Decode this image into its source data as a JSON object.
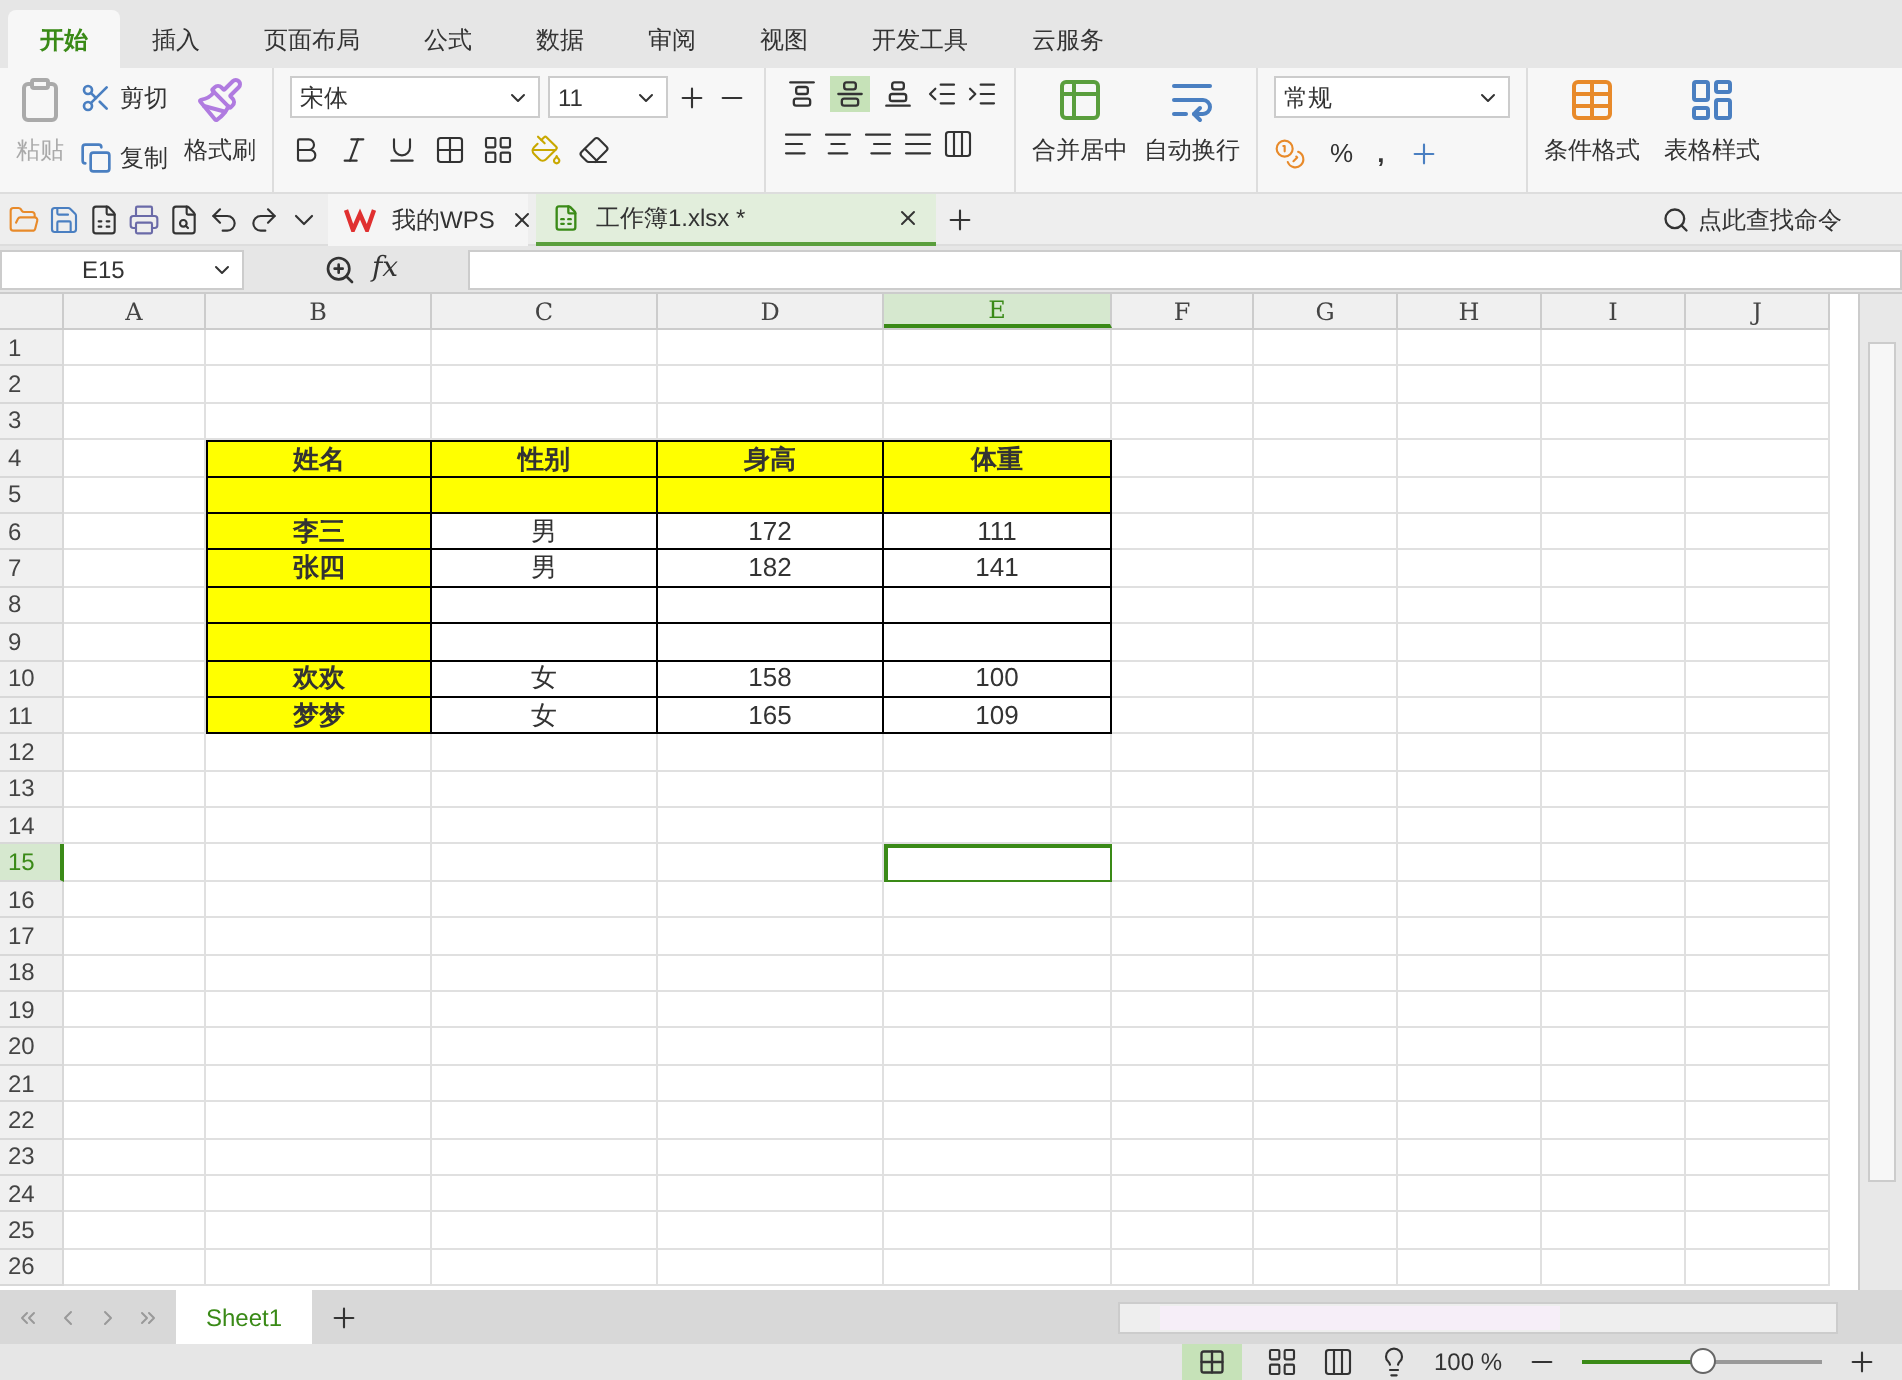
{
  "menu_tabs": [
    {
      "label": "开始",
      "selected": true
    },
    {
      "label": "插入",
      "selected": false
    },
    {
      "label": "页面布局",
      "selected": false
    },
    {
      "label": "公式",
      "selected": false
    },
    {
      "label": "数据",
      "selected": false
    },
    {
      "label": "审阅",
      "selected": false
    },
    {
      "label": "视图",
      "selected": false
    },
    {
      "label": "开发工具",
      "selected": false
    },
    {
      "label": "云服务",
      "selected": false
    }
  ],
  "clipboard": {
    "paste": {
      "label": "粘贴",
      "disabled": true
    },
    "cut": "剪切",
    "copy": "复制",
    "format_painter": "格式刷"
  },
  "font": {
    "name": "宋体",
    "size": "11"
  },
  "alignment": [
    {
      "kind": "top",
      "selected": false
    },
    {
      "kind": "middle",
      "selected": true
    },
    {
      "kind": "bottom",
      "selected": false
    }
  ],
  "merge": "合并居中",
  "wrap": "自动换行",
  "number": {
    "format": "常规",
    "percent": "%",
    "comma": ","
  },
  "styles": {
    "conditional": "条件格式",
    "table_style": "表格样式"
  },
  "doc_tabs": [
    {
      "label": "我的WPS",
      "kind": "home",
      "selected": false
    },
    {
      "label": "工作簿1.xlsx *",
      "kind": "sheet",
      "selected": true
    }
  ],
  "command_search": {
    "placeholder": "点此查找命令"
  },
  "name_box": "E15",
  "formula_icon": "fx",
  "columns": [
    {
      "label": "A",
      "selected": false
    },
    {
      "label": "B",
      "selected": false
    },
    {
      "label": "C",
      "selected": false
    },
    {
      "label": "D",
      "selected": false
    },
    {
      "label": "E",
      "selected": true
    },
    {
      "label": "F",
      "selected": false
    },
    {
      "label": "G",
      "selected": false
    },
    {
      "label": "H",
      "selected": false
    },
    {
      "label": "I",
      "selected": false
    },
    {
      "label": "J",
      "selected": false
    }
  ],
  "rows": [
    {
      "number": "1",
      "selected": false
    },
    {
      "number": "2",
      "selected": false
    },
    {
      "number": "3",
      "selected": false
    },
    {
      "number": "4",
      "selected": false,
      "cells": [
        {
          "text": "姓名",
          "fill": true,
          "bold": true
        },
        {
          "text": "性别",
          "fill": true,
          "bold": true
        },
        {
          "text": "身高",
          "fill": true,
          "bold": true
        },
        {
          "text": "体重",
          "fill": true,
          "bold": true
        }
      ]
    },
    {
      "number": "5",
      "selected": false,
      "cells": [
        {
          "fill": true
        },
        {
          "fill": true
        },
        {
          "fill": true
        },
        {
          "fill": true
        }
      ]
    },
    {
      "number": "6",
      "selected": false,
      "cells": [
        {
          "text": "李三",
          "fill": true,
          "bold": true
        },
        {
          "text": "男",
          "fill": false,
          "bold": false
        },
        {
          "text": "172",
          "fill": false,
          "bold": false
        },
        {
          "text": "111",
          "fill": false,
          "bold": false
        }
      ]
    },
    {
      "number": "7",
      "selected": false,
      "cells": [
        {
          "text": "张四",
          "fill": true,
          "bold": true
        },
        {
          "text": "男",
          "fill": false,
          "bold": false
        },
        {
          "text": "182",
          "fill": false,
          "bold": false
        },
        {
          "text": "141",
          "fill": false,
          "bold": false
        }
      ]
    },
    {
      "number": "8",
      "selected": false,
      "cells": [
        {
          "fill": true
        },
        {
          "fill": false
        },
        {
          "fill": false
        },
        {
          "fill": false
        }
      ]
    },
    {
      "number": "9",
      "selected": false,
      "cells": [
        {
          "fill": true
        },
        {
          "fill": false
        },
        {
          "fill": false
        },
        {
          "fill": false
        }
      ]
    },
    {
      "number": "10",
      "selected": false,
      "cells": [
        {
          "text": "欢欢",
          "fill": true,
          "bold": true
        },
        {
          "text": "女",
          "fill": false,
          "bold": false
        },
        {
          "text": "158",
          "fill": false,
          "bold": false
        },
        {
          "text": "100",
          "fill": false,
          "bold": false
        }
      ]
    },
    {
      "number": "11",
      "selected": false,
      "cells": [
        {
          "text": "梦梦",
          "fill": true,
          "bold": true
        },
        {
          "text": "女",
          "fill": false,
          "bold": false
        },
        {
          "text": "165",
          "fill": false,
          "bold": false
        },
        {
          "text": "109",
          "fill": false,
          "bold": false
        }
      ]
    },
    {
      "number": "12",
      "selected": false
    },
    {
      "number": "13",
      "selected": false
    },
    {
      "number": "14",
      "selected": false
    },
    {
      "number": "15",
      "selected": true
    },
    {
      "number": "16",
      "selected": false
    },
    {
      "number": "17",
      "selected": false
    },
    {
      "number": "18",
      "selected": false
    },
    {
      "number": "19",
      "selected": false
    },
    {
      "number": "20",
      "selected": false
    },
    {
      "number": "21",
      "selected": false
    },
    {
      "number": "22",
      "selected": false
    },
    {
      "number": "23",
      "selected": false
    },
    {
      "number": "24",
      "selected": false
    },
    {
      "number": "25",
      "selected": false
    },
    {
      "number": "26",
      "selected": false
    }
  ],
  "sheet_tabs": [
    {
      "label": "Sheet1",
      "selected": true
    }
  ],
  "status_bar": {
    "zoom": "100 %",
    "zoom_slider": {
      "level": 0.5
    }
  }
}
